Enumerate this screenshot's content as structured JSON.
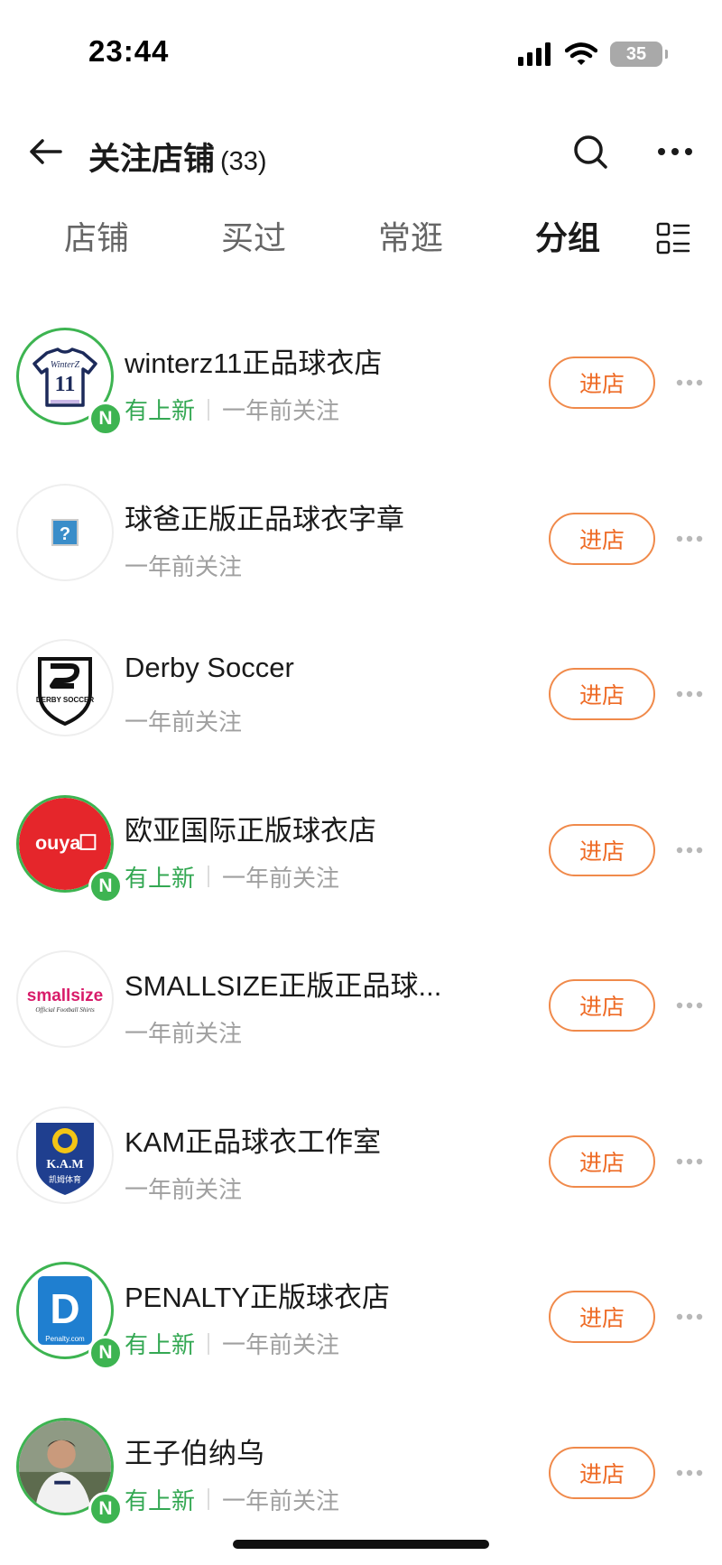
{
  "status_bar": {
    "time": "23:44",
    "battery": "35"
  },
  "nav": {
    "title": "关注店铺",
    "count": "(33)"
  },
  "tabs": [
    {
      "label": "店铺",
      "active": false
    },
    {
      "label": "买过",
      "active": false
    },
    {
      "label": "常逛",
      "active": false
    },
    {
      "label": "分组",
      "active": true
    }
  ],
  "shops": [
    {
      "name": "winterz11正品球衣店",
      "has_new": true,
      "new_label": "有上新",
      "followed": "一年前关注",
      "enter_label": "进店",
      "logo": "winterz-jersey-logo",
      "logo_text": "WinterZ",
      "logo_number": "11"
    },
    {
      "name": "球爸正版正品球衣字章",
      "has_new": false,
      "new_label": "",
      "followed": "一年前关注",
      "enter_label": "进店",
      "logo": "missing-image-icon",
      "logo_text": "?"
    },
    {
      "name": "Derby Soccer",
      "has_new": false,
      "new_label": "",
      "followed": "一年前关注",
      "enter_label": "进店",
      "logo": "derby-soccer-shield-logo",
      "logo_text": "DERBY SOCCER"
    },
    {
      "name": "欧亚国际正版球衣店",
      "has_new": true,
      "new_label": "有上新",
      "followed": "一年前关注",
      "enter_label": "进店",
      "logo": "ouya-logo",
      "logo_text": "ouya"
    },
    {
      "name": "SMALLSIZE正版正品球...",
      "has_new": false,
      "new_label": "",
      "followed": "一年前关注",
      "enter_label": "进店",
      "logo": "smallsize-logo",
      "logo_text": "smallsize",
      "logo_subtext": "Official Football Shirts"
    },
    {
      "name": "KAM正品球衣工作室",
      "has_new": false,
      "new_label": "",
      "followed": "一年前关注",
      "enter_label": "进店",
      "logo": "kam-shield-logo",
      "logo_text": "K.A.M",
      "logo_subtext": "凯姆体育"
    },
    {
      "name": "PENALTY正版球衣店",
      "has_new": true,
      "new_label": "有上新",
      "followed": "一年前关注",
      "enter_label": "进店",
      "logo": "penalty-logo",
      "logo_text": "D",
      "logo_subtext": "Penalty.com"
    },
    {
      "name": "王子伯纳乌",
      "has_new": true,
      "new_label": "有上新",
      "followed": "一年前关注",
      "enter_label": "进店",
      "logo": "player-photo-avatar"
    }
  ],
  "badge_letter": "N",
  "colors": {
    "accent_green": "#3db451",
    "enter_orange": "#ee6b26",
    "muted_text": "#a0a0a0"
  }
}
